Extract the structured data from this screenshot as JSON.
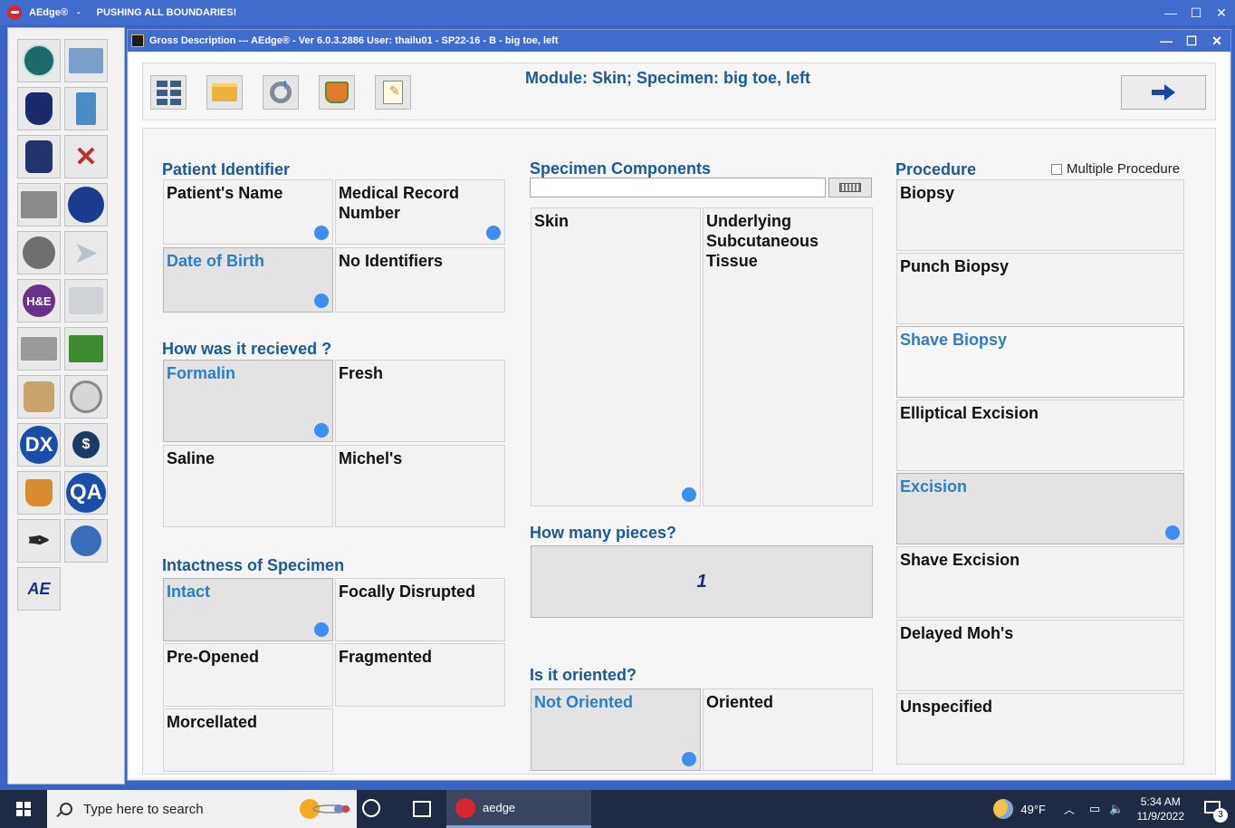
{
  "outer_window": {
    "app_name": "AEdge®",
    "separator": "-",
    "tagline": "PUSHING ALL BOUNDARIES!",
    "controls": {
      "minimize": "—",
      "maximize": "☐",
      "close": "✕"
    }
  },
  "sidebar": {
    "icons": [
      "network-icon",
      "computer-icon",
      "specimen-jar-icon",
      "hourglass-icon",
      "edit-jar-icon",
      "tools-icon",
      "processor-icon",
      "globe-icon",
      "microtome-icon",
      "paper-plane-icon",
      "he-stain-icon",
      "fax-icon",
      "slides-icon",
      "email-icon",
      "slide-magnify-icon",
      "document-search-icon",
      "dx-icon",
      "billing-icon",
      "beakers-icon",
      "qa-icon",
      "pen-icon",
      "help-globe-icon",
      "aedoc-icon"
    ],
    "dx_label": "DX",
    "qa_label": "QA",
    "he_label": "H&E",
    "billing_label": "$"
  },
  "inner_window": {
    "title": "Gross Description --- AEdge®  -  Ver 6.0.3.2886  User: thailu01  - SP22-16 - B - big toe, left",
    "controls": {
      "minimize": "—",
      "maximize": "☐",
      "close": "✕"
    }
  },
  "toolbar": {
    "module_title": "Module: Skin; Specimen: big toe, left"
  },
  "patient_identifier": {
    "label": "Patient Identifier",
    "options": [
      {
        "label": "Patient's Name",
        "selected": false,
        "dot": true
      },
      {
        "label": "Medical Record Number",
        "selected": false,
        "dot": true
      },
      {
        "label": "Date of Birth",
        "selected": true,
        "dot": true
      },
      {
        "label": "No Identifiers",
        "selected": false,
        "dot": false
      }
    ]
  },
  "received": {
    "label": "How was it recieved ?",
    "options": [
      {
        "label": "Formalin",
        "selected": true,
        "dot": true
      },
      {
        "label": "Fresh",
        "selected": false,
        "dot": false
      },
      {
        "label": "Saline",
        "selected": false,
        "dot": false
      },
      {
        "label": "Michel's",
        "selected": false,
        "dot": false
      }
    ]
  },
  "intactness": {
    "label": "Intactness of Specimen",
    "options": [
      {
        "label": "Intact",
        "selected": true,
        "dot": true
      },
      {
        "label": "Focally Disrupted",
        "selected": false,
        "dot": false
      },
      {
        "label": "Pre-Opened",
        "selected": false,
        "dot": false
      },
      {
        "label": "Fragmented",
        "selected": false,
        "dot": false
      },
      {
        "label": "Morcellated",
        "selected": false,
        "dot": false
      }
    ]
  },
  "components": {
    "label": "Specimen Components",
    "search_value": "",
    "options": [
      {
        "label": "Skin",
        "selected": false,
        "dot": true
      },
      {
        "label": "Underlying Subcutaneous Tissue",
        "selected": false,
        "dot": false
      }
    ]
  },
  "pieces": {
    "label": "How many pieces?",
    "value": "1"
  },
  "oriented": {
    "label": "Is it oriented?",
    "options": [
      {
        "label": "Not Oriented",
        "selected": true,
        "dot": true
      },
      {
        "label": "Oriented",
        "selected": false,
        "dot": false
      }
    ]
  },
  "procedure": {
    "label": "Procedure",
    "multiple_label": "Multiple Procedure",
    "multiple_checked": false,
    "options": [
      {
        "label": "Biopsy",
        "selected": false,
        "dot": false
      },
      {
        "label": "Punch Biopsy",
        "selected": false,
        "dot": false
      },
      {
        "label": "Shave Biopsy",
        "selected": false,
        "highlight": true,
        "dot": false
      },
      {
        "label": "Elliptical Excision",
        "selected": false,
        "dot": false
      },
      {
        "label": "Excision",
        "selected": true,
        "dot": true
      },
      {
        "label": "Shave Excision",
        "selected": false,
        "dot": false
      },
      {
        "label": "Delayed Moh's",
        "selected": false,
        "dot": false
      },
      {
        "label": "Unspecified",
        "selected": false,
        "dot": false
      }
    ]
  },
  "taskbar": {
    "search_placeholder": "Type here to search",
    "app_label": "aedge",
    "weather": "49°F",
    "time": "5:34 AM",
    "date": "11/9/2022",
    "notifications": "3"
  },
  "colors": {
    "accent_blue": "#1a5a97",
    "selected_text": "#2a7ec7",
    "dot": "#3d8ef0",
    "titlebar": "#3f6ccd"
  }
}
